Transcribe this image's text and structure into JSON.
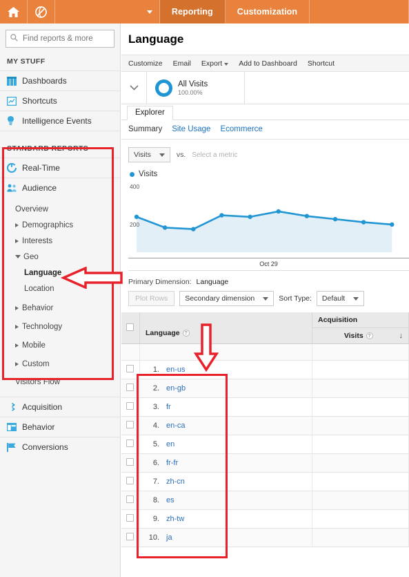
{
  "topbar": {
    "home_icon": "home-icon",
    "globe_icon": "analytics-globe-icon",
    "account_caret": "chevron-down-icon",
    "tabs": [
      {
        "label": "Reporting",
        "active": true
      },
      {
        "label": "Customization",
        "active": false
      }
    ]
  },
  "sidebar": {
    "search": {
      "placeholder": "Find reports & more",
      "value": ""
    },
    "my_stuff_heading": "MY STUFF",
    "my_stuff": [
      {
        "label": "Dashboards",
        "icon": "dashboard-grid-icon"
      },
      {
        "label": "Shortcuts",
        "icon": "shortcut-icon"
      },
      {
        "label": "Intelligence Events",
        "icon": "lightbulb-icon"
      }
    ],
    "standard_reports_heading": "STANDARD REPORTS",
    "standard_reports": [
      {
        "label": "Real-Time",
        "icon": "realtime-clock-icon"
      },
      {
        "label": "Audience",
        "icon": "audience-people-icon"
      }
    ],
    "audience_children": [
      {
        "label": "Overview",
        "arrow": "none",
        "selected": false
      },
      {
        "label": "Demographics",
        "arrow": "collapsed",
        "selected": false
      },
      {
        "label": "Interests",
        "arrow": "collapsed",
        "selected": false
      },
      {
        "label": "Geo",
        "arrow": "expanded",
        "selected": false
      },
      {
        "label": "Language",
        "arrow": "none",
        "indent": 2,
        "selected": true
      },
      {
        "label": "Location",
        "arrow": "none",
        "indent": 2,
        "selected": false
      },
      {
        "label": "Behavior",
        "arrow": "collapsed",
        "selected": false
      },
      {
        "label": "Technology",
        "arrow": "collapsed",
        "selected": false
      },
      {
        "label": "Mobile",
        "arrow": "collapsed",
        "selected": false
      },
      {
        "label": "Custom",
        "arrow": "collapsed",
        "selected": false
      },
      {
        "label": "Visitors Flow",
        "arrow": "none",
        "selected": false
      }
    ],
    "bottom_sections": [
      {
        "label": "Acquisition",
        "icon": "acquisition-arrows-icon"
      },
      {
        "label": "Behavior",
        "icon": "behavior-window-icon"
      },
      {
        "label": "Conversions",
        "icon": "conversions-flag-icon"
      }
    ]
  },
  "main": {
    "page_title": "Language",
    "actions": [
      {
        "label": "Customize",
        "caret": false
      },
      {
        "label": "Email",
        "caret": false
      },
      {
        "label": "Export",
        "caret": true
      },
      {
        "label": "Add to Dashboard",
        "caret": false
      },
      {
        "label": "Shortcut",
        "caret": false
      }
    ],
    "segment": {
      "toggle_icon": "chevron-down-icon",
      "name": "All Visits",
      "percent": "100.00%"
    },
    "explorer_tab": "Explorer",
    "subtabs": [
      {
        "label": "Summary",
        "active": true
      },
      {
        "label": "Site Usage",
        "active": false
      },
      {
        "label": "Ecommerce",
        "active": false
      }
    ],
    "metric_selector": {
      "value": "Visits",
      "caret_icon": "chevron-down-icon"
    },
    "vs_label": "vs.",
    "select_metric_label": "Select a metric",
    "primary_dimension": {
      "label": "Primary Dimension:",
      "value": "Language"
    },
    "controls": {
      "plot_rows": "Plot Rows",
      "secondary_dimension": "Secondary dimension",
      "sort_type_label": "Sort Type:",
      "sort_type_value": "Default"
    },
    "table": {
      "group_header": "Acquisition",
      "dimension_header": "Language",
      "metric_header": "Visits",
      "sort_indicator": "↓",
      "rows": [
        {
          "num": "1.",
          "language": "en-us"
        },
        {
          "num": "2.",
          "language": "en-gb"
        },
        {
          "num": "3.",
          "language": "fr"
        },
        {
          "num": "4.",
          "language": "en-ca"
        },
        {
          "num": "5.",
          "language": "en"
        },
        {
          "num": "6.",
          "language": "fr-fr"
        },
        {
          "num": "7.",
          "language": "zh-cn"
        },
        {
          "num": "8.",
          "language": "es"
        },
        {
          "num": "9.",
          "language": "zh-tw"
        },
        {
          "num": "10.",
          "language": "ja"
        }
      ]
    }
  },
  "chart_data": {
    "type": "area",
    "title": "",
    "legend": [
      "Visits"
    ],
    "legend_position": "top-left",
    "xlabel": "",
    "ylabel": "",
    "x_tick_labels": [
      "Oct 29"
    ],
    "y_tick_labels": [
      "400",
      "200"
    ],
    "ylim": [
      0,
      440
    ],
    "grid": false,
    "series": [
      {
        "name": "Visits",
        "color": "#2196d3",
        "values": [
          230,
          160,
          150,
          240,
          230,
          265,
          235,
          215,
          195,
          180
        ]
      }
    ]
  },
  "annotations": {
    "color": "#e8222a",
    "boxes": [
      {
        "name": "sidebar-standard-reports-highlight"
      },
      {
        "name": "table-language-column-highlight"
      }
    ],
    "arrows": [
      {
        "name": "arrow-pointing-to-language-nav",
        "direction": "left"
      },
      {
        "name": "arrow-pointing-to-language-column",
        "direction": "down"
      }
    ]
  }
}
